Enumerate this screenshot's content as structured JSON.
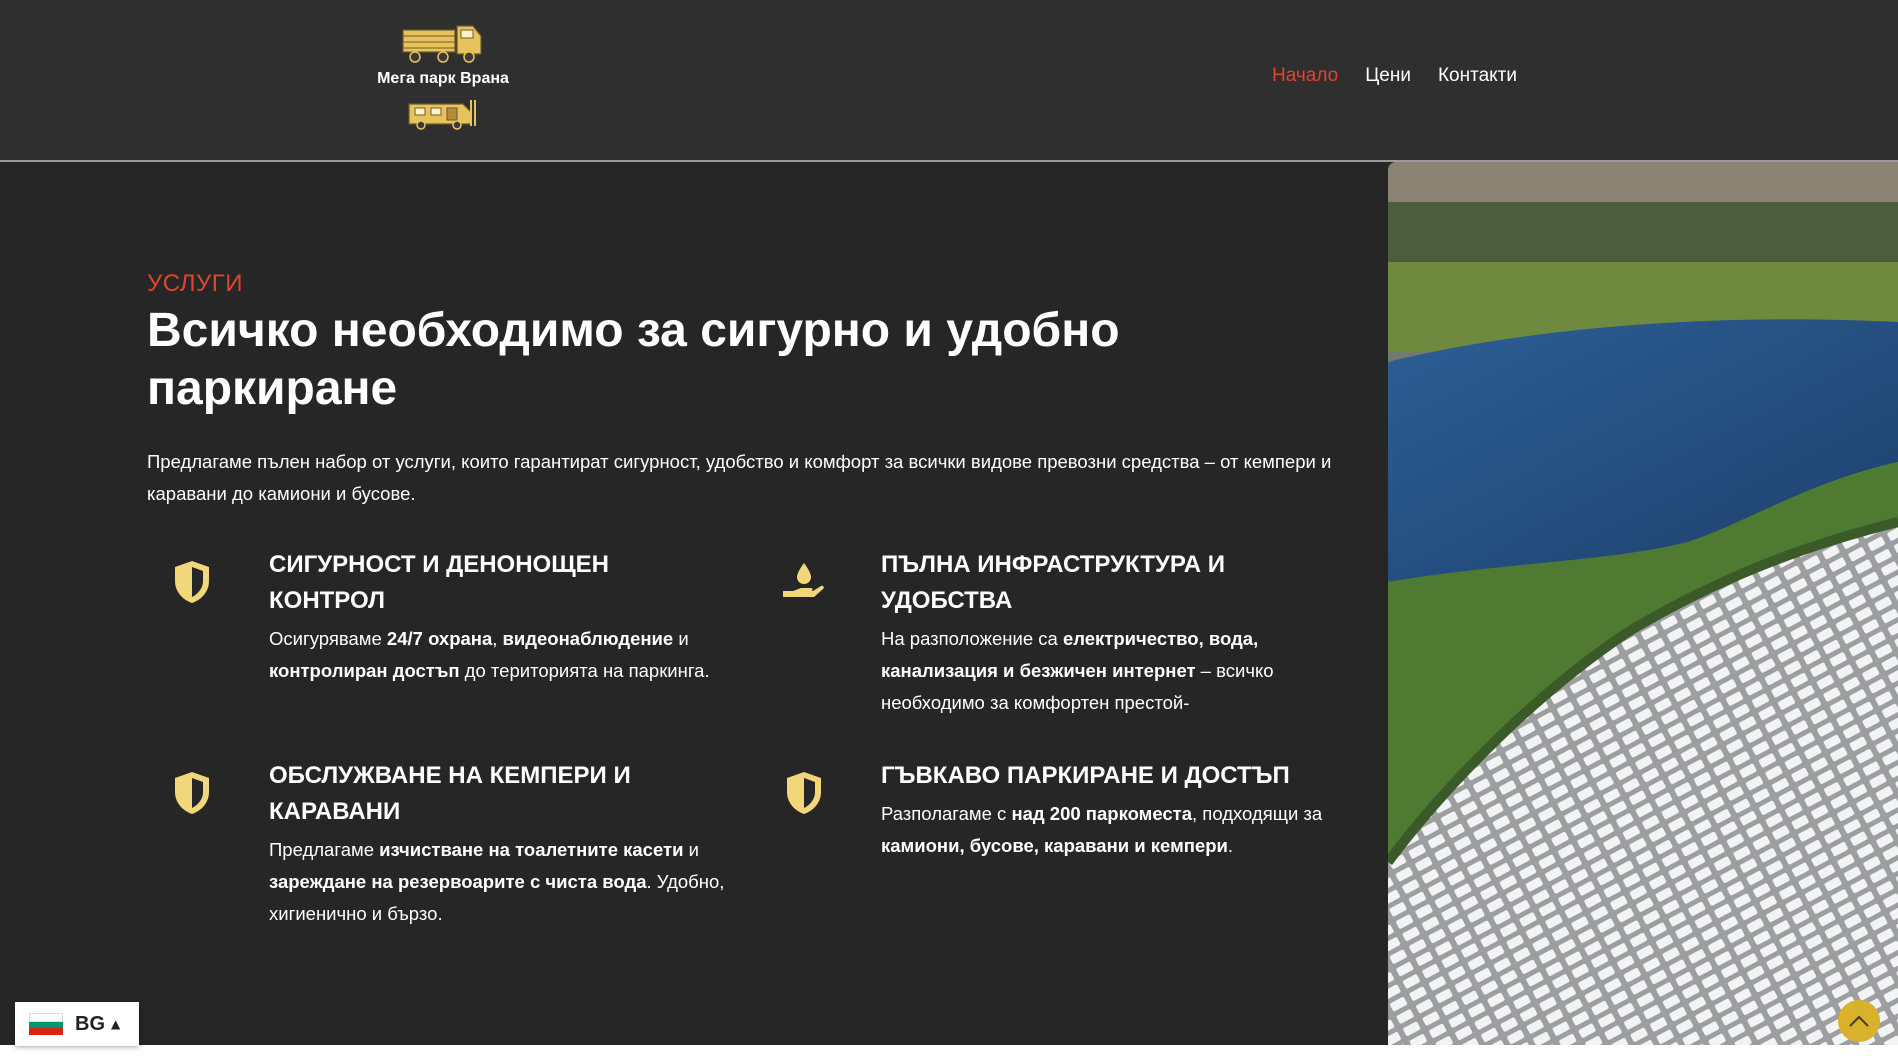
{
  "colors": {
    "header_bg": "#2f2f2f",
    "section_bg": "#262626",
    "accent_red": "#e0442f",
    "icon_gold": "#f1d67a",
    "scroll_top_bg": "#d9b12a"
  },
  "header": {
    "brand_name": "Мега парк Врана",
    "nav": [
      {
        "label": "Начало",
        "active": true
      },
      {
        "label": "Цени",
        "active": false
      },
      {
        "label": "Контакти",
        "active": false
      }
    ]
  },
  "services": {
    "eyebrow": "УСЛУГИ",
    "headline": "Всичко необходимо за сигурно и удобно паркиране",
    "intro": "Предлагаме пълен набор от услуги, които гарантират сигурност, удобство и комфорт за всички видове превозни средства – от кемпери и каравани до камиони и бусове.",
    "features": [
      {
        "icon": "shield-icon",
        "title": "СИГУРНОСТ И ДЕНОНОЩЕН КОНТРОЛ",
        "text": [
          {
            "t": "Осигуряваме ",
            "b": false
          },
          {
            "t": "24/7 охрана",
            "b": true
          },
          {
            "t": ", ",
            "b": false
          },
          {
            "t": "видеонаблюдение",
            "b": true
          },
          {
            "t": " и ",
            "b": false
          },
          {
            "t": "контролиран достъп",
            "b": true
          },
          {
            "t": " до територията на паркинга.",
            "b": false
          }
        ]
      },
      {
        "icon": "hand-water-drop-icon",
        "title": "ПЪЛНА ИНФРАСТРУКТУРА И УДОБСТВА",
        "text": [
          {
            "t": "На разположение са ",
            "b": false
          },
          {
            "t": "електричество, вода, канализация и безжичен интернет",
            "b": true
          },
          {
            "t": " – всичко необходимо за комфортен престой-",
            "b": false
          }
        ]
      },
      {
        "icon": "shield-icon",
        "title": "ОБСЛУЖВАНЕ НА КЕМПЕРИ И КАРАВАНИ",
        "text": [
          {
            "t": "Предлагаме ",
            "b": false
          },
          {
            "t": "изчистване на тоалетните касети",
            "b": true
          },
          {
            "t": " и ",
            "b": false
          },
          {
            "t": "зареждане на резервоарите с чиста вода",
            "b": true
          },
          {
            "t": ". Удобно, хигиенично и бързо.",
            "b": false
          }
        ]
      },
      {
        "icon": "shield-icon",
        "title": "ГЪВКАВО ПАРКИРАНЕ И ДОСТЪП",
        "text": [
          {
            "t": "Разполагаме с ",
            "b": false
          },
          {
            "t": "над 200 паркоместа",
            "b": true
          },
          {
            "t": ", подходящи за ",
            "b": false
          },
          {
            "t": "камиони, бусове, каравани и кемпери",
            "b": true
          },
          {
            "t": ".",
            "b": false
          }
        ]
      }
    ]
  },
  "language": {
    "code": "BG",
    "flag_colors": [
      "#ffffff",
      "#00966e",
      "#d62612"
    ]
  },
  "scroll_top": {
    "icon": "chevron-up-icon"
  }
}
